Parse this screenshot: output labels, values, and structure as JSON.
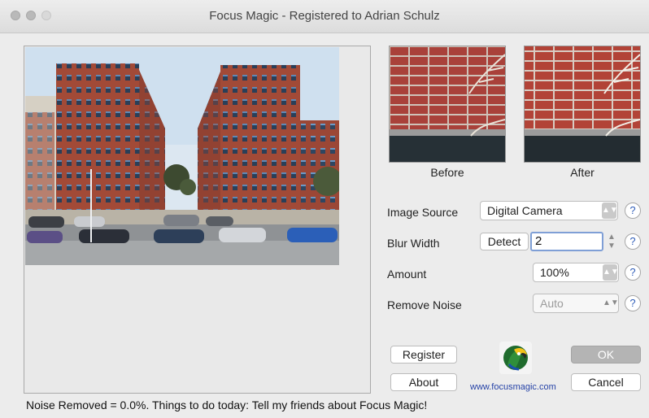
{
  "window": {
    "title": "Focus Magic - Registered to Adrian Schulz"
  },
  "preview": {
    "before_label": "Before",
    "after_label": "After"
  },
  "settings": {
    "image_source": {
      "label": "Image Source",
      "value": "Digital Camera"
    },
    "blur_width": {
      "label": "Blur Width",
      "detect_label": "Detect",
      "value": "2"
    },
    "amount": {
      "label": "Amount",
      "value": "100%"
    },
    "remove_noise": {
      "label": "Remove Noise",
      "value": "Auto"
    },
    "help_symbol": "?"
  },
  "buttons": {
    "register": "Register",
    "about": "About",
    "ok": "OK",
    "cancel": "Cancel"
  },
  "brand": {
    "website": "www.focusmagic.com"
  },
  "status": {
    "text": "Noise Removed = 0.0%. Things to do today: Tell my friends about Focus Magic!"
  },
  "icons": {
    "close": "traffic-light-close",
    "minimize": "traffic-light-minimize",
    "zoom": "traffic-light-zoom",
    "stepper": "up-down-stepper",
    "logo": "parrot-logo"
  },
  "colors": {
    "help_blue": "#2f5db8",
    "link_blue": "#2643a7",
    "focus_ring": "#7f9fd6"
  }
}
